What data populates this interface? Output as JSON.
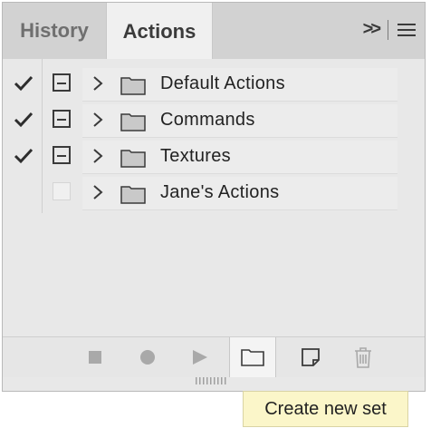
{
  "tabs": [
    {
      "label": "History",
      "active": false
    },
    {
      "label": "Actions",
      "active": true
    }
  ],
  "tab_tools": {
    "expand_icon": "double-chevron-right-icon",
    "menu_icon": "hamburger-menu-icon"
  },
  "action_sets": [
    {
      "label": "Default Actions",
      "checked": true,
      "dialog": true
    },
    {
      "label": "Commands",
      "checked": true,
      "dialog": true
    },
    {
      "label": "Textures",
      "checked": true,
      "dialog": true
    },
    {
      "label": "Jane's Actions",
      "checked": false,
      "dialog": false
    }
  ],
  "footer_buttons": [
    {
      "name": "stop-icon",
      "disabled": true
    },
    {
      "name": "record-icon",
      "disabled": true
    },
    {
      "name": "play-icon",
      "disabled": true
    },
    {
      "name": "new-set-folder-icon",
      "disabled": false,
      "hovered": true
    },
    {
      "name": "new-action-icon",
      "disabled": false
    },
    {
      "name": "trash-icon",
      "disabled": true
    }
  ],
  "tooltip": {
    "text": "Create new set"
  },
  "colors": {
    "accent_dark": "#3a3a3a",
    "disabled": "#a9a9a9",
    "tooltip_bg": "#fbf6c9"
  }
}
